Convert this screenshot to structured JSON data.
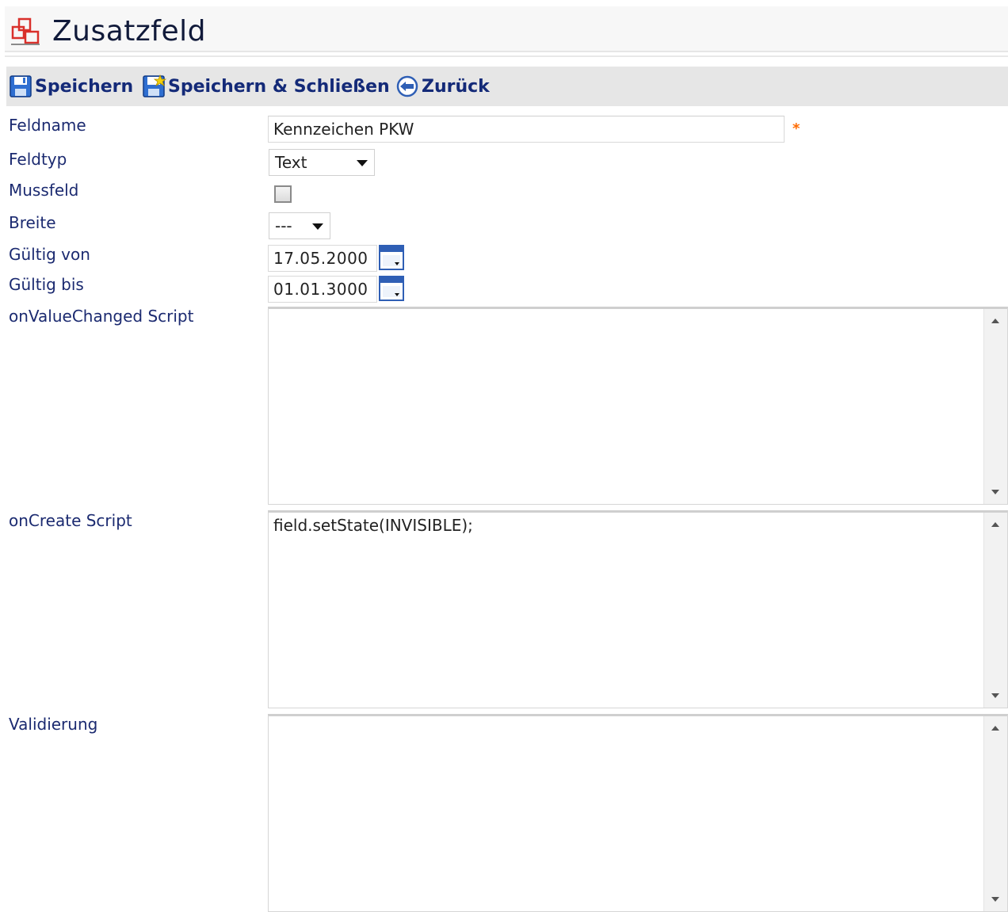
{
  "header": {
    "title": "Zusatzfeld"
  },
  "toolbar": {
    "save_label": "Speichern",
    "save_close_label": "Speichern & Schließen",
    "back_label": "Zurück"
  },
  "form": {
    "feldname": {
      "label": "Feldname",
      "value": "Kennzeichen PKW",
      "required_mark": "*"
    },
    "feldtyp": {
      "label": "Feldtyp",
      "value": "Text"
    },
    "mussfeld": {
      "label": "Mussfeld",
      "checked": false
    },
    "breite": {
      "label": "Breite",
      "value": "---"
    },
    "gueltig_von": {
      "label": "Gültig von",
      "value": "17.05.2000"
    },
    "gueltig_bis": {
      "label": "Gültig bis",
      "value": "01.01.3000"
    },
    "on_value_changed": {
      "label": "onValueChanged Script",
      "value": ""
    },
    "on_create": {
      "label": "onCreate Script",
      "value": "field.setState(INVISIBLE);"
    },
    "validierung": {
      "label": "Validierung",
      "value": ""
    }
  },
  "colors": {
    "label_text": "#1b2a70",
    "toolbar_bg": "#e6e6e6",
    "toolbar_text": "#142a78",
    "required": "#ff6a00",
    "title_icon": "#d9302b"
  },
  "icons": {
    "title": "form-field-icon",
    "save": "floppy-disk-icon",
    "save_close": "floppy-disk-star-icon",
    "back": "back-arrow-icon",
    "calendar": "calendar-icon"
  }
}
